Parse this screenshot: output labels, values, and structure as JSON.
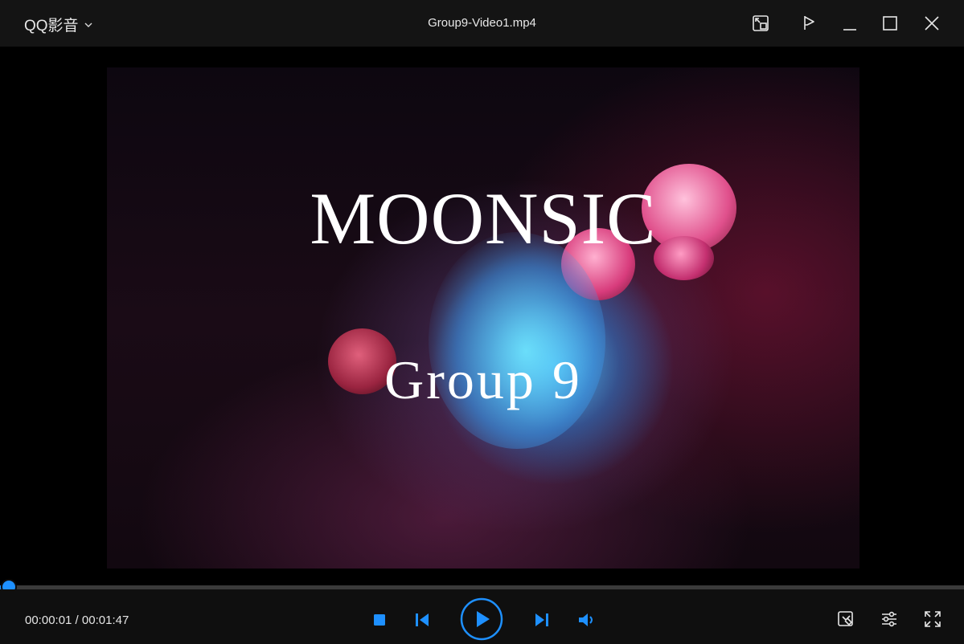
{
  "app": {
    "name": "QQ影音"
  },
  "window": {
    "title": "Group9-Video1.mp4"
  },
  "video": {
    "title_text": "MOONSIC",
    "subtitle_text": "Group 9"
  },
  "playback": {
    "current_time": "00:00:01",
    "total_time": "00:01:47",
    "time_separator": " / ",
    "progress_fraction": 0.0093
  },
  "colors": {
    "accent": "#1e90ff",
    "titlebar_bg": "#141414",
    "controls_bg": "#0f0f0f"
  },
  "icons": {
    "titlebar": [
      "mini-mode-icon",
      "pin-icon",
      "minimize-icon",
      "maximize-icon",
      "close-icon"
    ],
    "center": [
      "stop-icon",
      "previous-icon",
      "play-icon",
      "next-icon",
      "volume-icon"
    ],
    "right": [
      "screenshot-tools-icon",
      "settings-sliders-icon",
      "fullscreen-icon"
    ]
  }
}
